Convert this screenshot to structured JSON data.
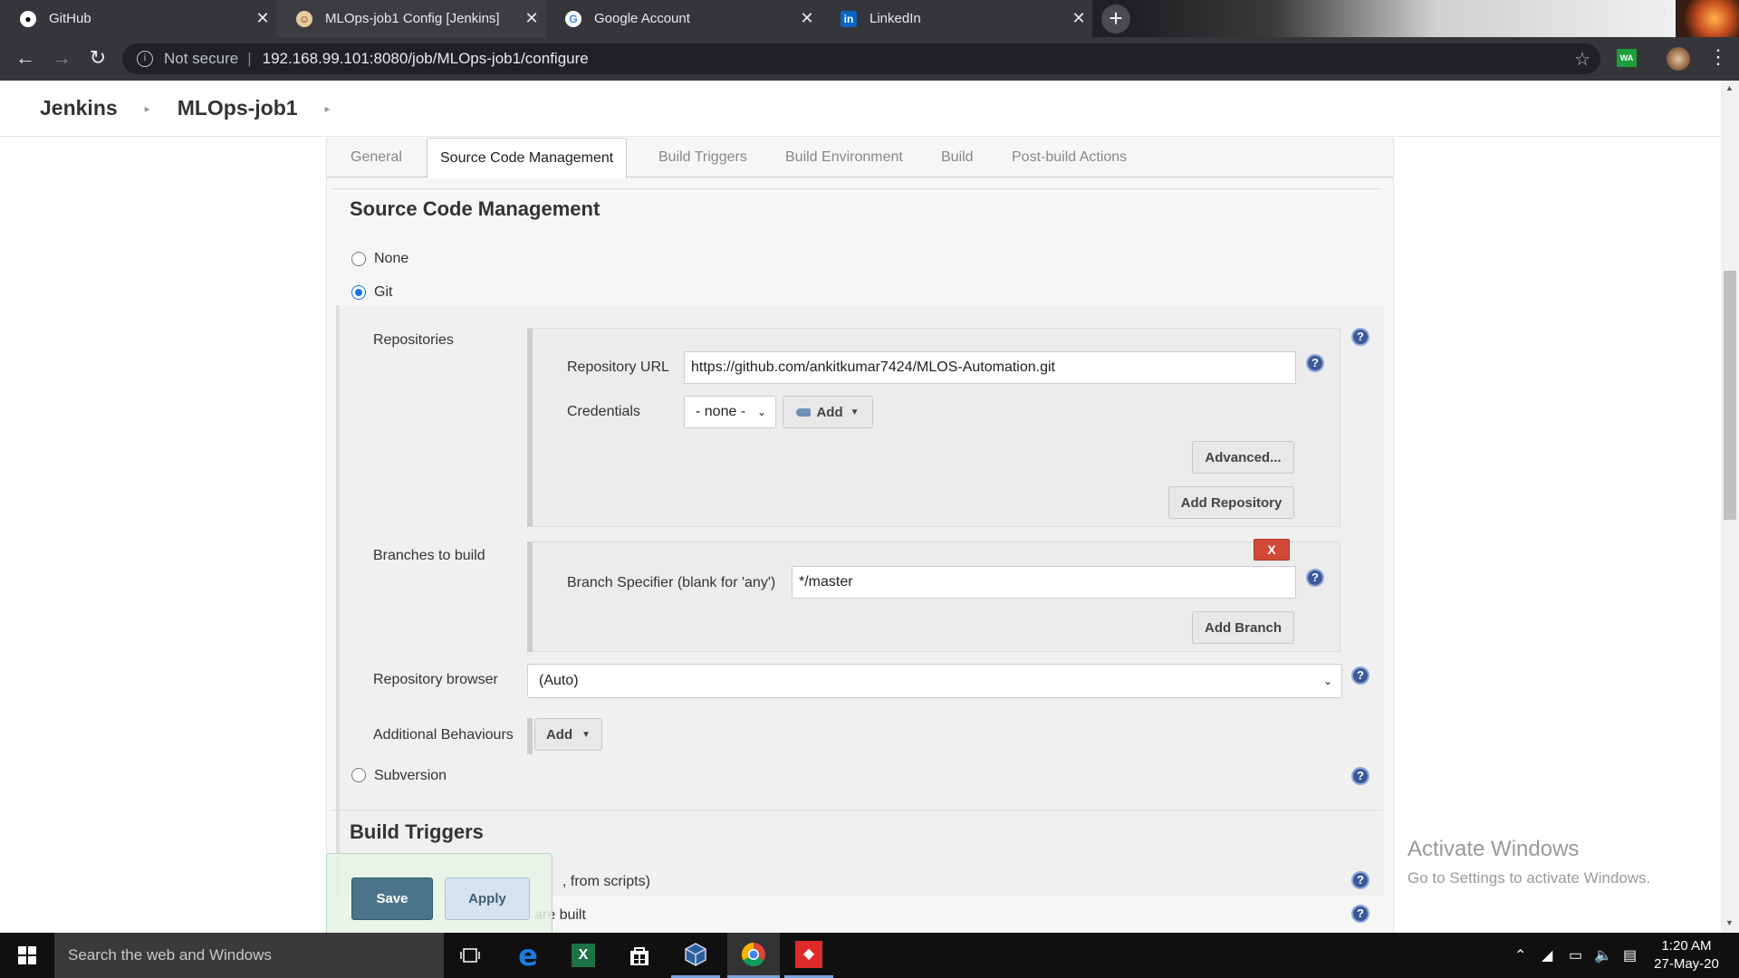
{
  "browser": {
    "tabs": [
      {
        "title": "GitHub",
        "favicon": "github-icon",
        "active": false
      },
      {
        "title": "MLOps-job1 Config [Jenkins]",
        "favicon": "jenkins-icon",
        "active": true
      },
      {
        "title": "Google Account",
        "favicon": "google-icon",
        "active": false
      },
      {
        "title": "LinkedIn",
        "favicon": "linkedin-icon",
        "active": false
      }
    ],
    "address": {
      "security_label": "Not secure",
      "url": "192.168.99.101:8080/job/MLOps-job1/configure"
    }
  },
  "jenkins": {
    "breadcrumbs": [
      "Jenkins",
      "MLOps-job1"
    ],
    "config_tabs": [
      "General",
      "Source Code Management",
      "Build Triggers",
      "Build Environment",
      "Build",
      "Post-build Actions"
    ],
    "active_tab": "Source Code Management",
    "scm": {
      "title": "Source Code Management",
      "options": {
        "none": "None",
        "git": "Git",
        "subversion": "Subversion"
      },
      "selected": "Git",
      "repositories": {
        "label": "Repositories",
        "url_label": "Repository URL",
        "url_value": "https://github.com/ankitkumar7424/MLOS-Automation.git",
        "credentials_label": "Credentials",
        "credentials_value": "- none -",
        "add_label": "Add",
        "advanced_label": "Advanced...",
        "add_repository_label": "Add Repository"
      },
      "branches": {
        "label": "Branches to build",
        "delete_label": "X",
        "specifier_label": "Branch Specifier (blank for 'any')",
        "specifier_value": "*/master",
        "add_branch_label": "Add Branch"
      },
      "repo_browser": {
        "label": "Repository browser",
        "value": "(Auto)"
      },
      "additional_behaviours": {
        "label": "Additional Behaviours",
        "add_label": "Add"
      }
    },
    "build_triggers": {
      "title": "Build Triggers",
      "rows": [
        ", from scripts)",
        "are built"
      ]
    },
    "actions": {
      "save": "Save",
      "apply": "Apply"
    }
  },
  "os": {
    "watermark_title": "Activate Windows",
    "watermark_sub": "Go to Settings to activate Windows.",
    "search_placeholder": "Search the web and Windows",
    "time": "1:20 AM",
    "date": "27-May-20"
  },
  "colors": {
    "jenkins_save": "#4b758b",
    "help_icon": "#3b5998",
    "delete_red": "#d24939",
    "radio_selected": "#1a73e8"
  }
}
